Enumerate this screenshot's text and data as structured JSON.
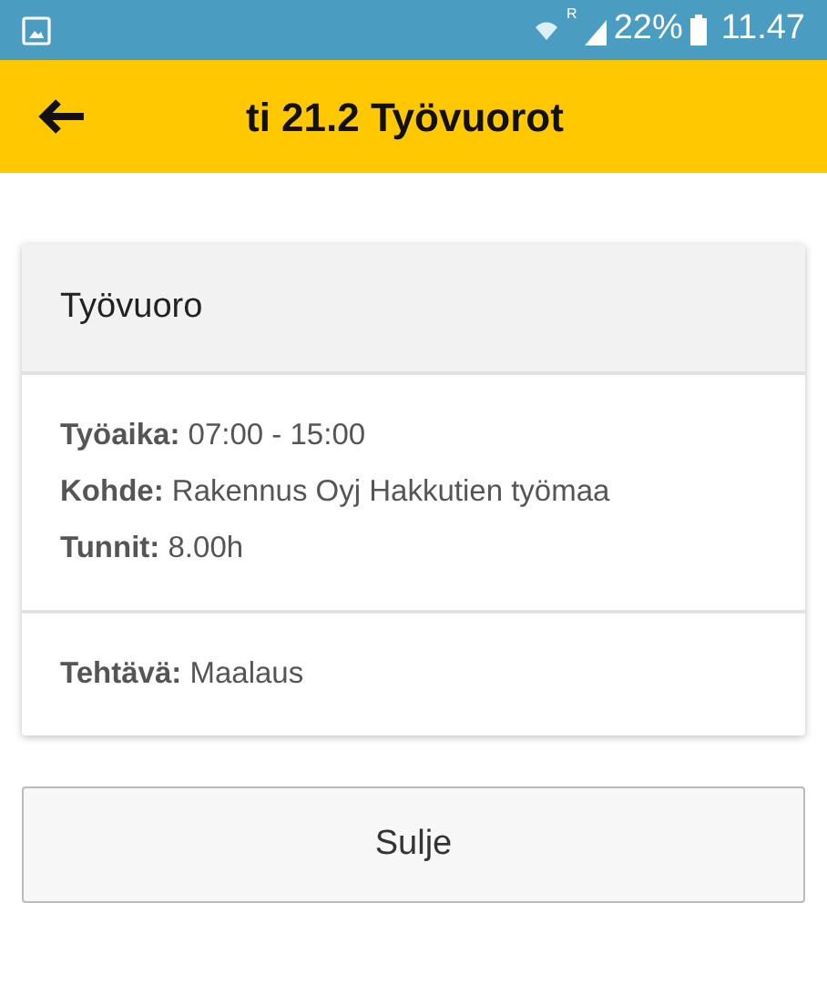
{
  "status_bar": {
    "battery": "22%",
    "roaming": "R",
    "time": "11.47"
  },
  "header": {
    "title": "ti 21.2 Työvuorot"
  },
  "card": {
    "title": "Työvuoro",
    "sections": [
      {
        "lines": [
          "**Työaika:** 07:00 - 15:00",
          "**Kohde:** Rakennus Oyj Hakkutien työmaa",
          "**Tunnit:** 8.00h"
        ]
      },
      {
        "lines": [
          "**Tehtävä:** Maalaus"
        ]
      }
    ]
  },
  "buttons": [
    "Sulje"
  ]
}
